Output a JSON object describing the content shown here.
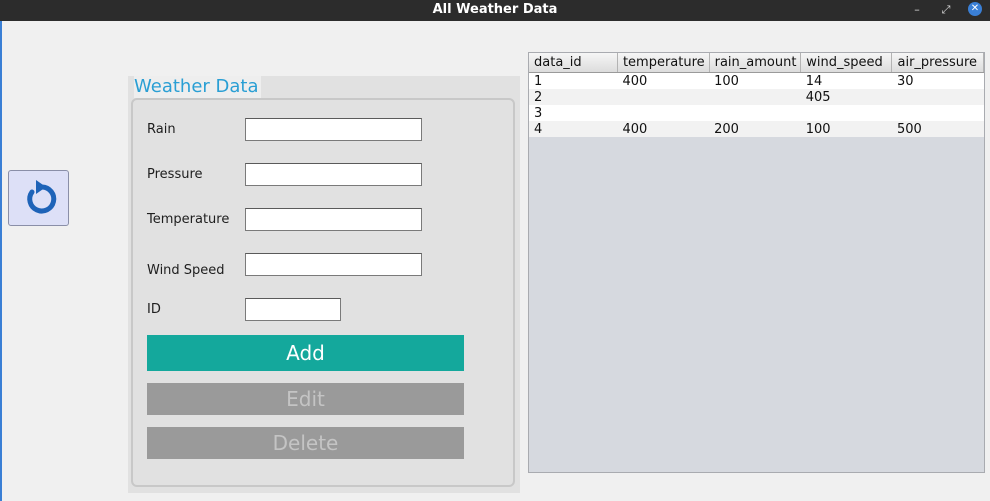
{
  "window": {
    "title": "All Weather Data",
    "min_glyph": "–",
    "max_glyph": "⤢",
    "close_glyph": "✕"
  },
  "back_button": {
    "icon": "undo-arrow-icon",
    "color": "#1e63b8"
  },
  "form": {
    "title": "Weather Data",
    "labels": {
      "rain": "Rain",
      "pressure": "Pressure",
      "temperature": "Temperature",
      "wind_speed": "Wind Speed",
      "id": "ID"
    },
    "values": {
      "rain": "",
      "pressure": "",
      "temperature": "",
      "wind_speed": "",
      "id": ""
    },
    "buttons": {
      "add": "Add",
      "edit": "Edit",
      "delete": "Delete"
    },
    "colors": {
      "add": "#14a89c",
      "disabled": "#9a9a9a",
      "title": "#2a9fd4"
    }
  },
  "table": {
    "columns": [
      "data_id",
      "temperature",
      "rain_amount",
      "wind_speed",
      "air_pressure"
    ],
    "rows": [
      [
        "1",
        "400",
        "100",
        "14",
        "30"
      ],
      [
        "2",
        "",
        "",
        "405",
        ""
      ],
      [
        "3",
        "",
        "",
        "",
        ""
      ],
      [
        "4",
        "400",
        "200",
        "100",
        "500"
      ]
    ]
  }
}
